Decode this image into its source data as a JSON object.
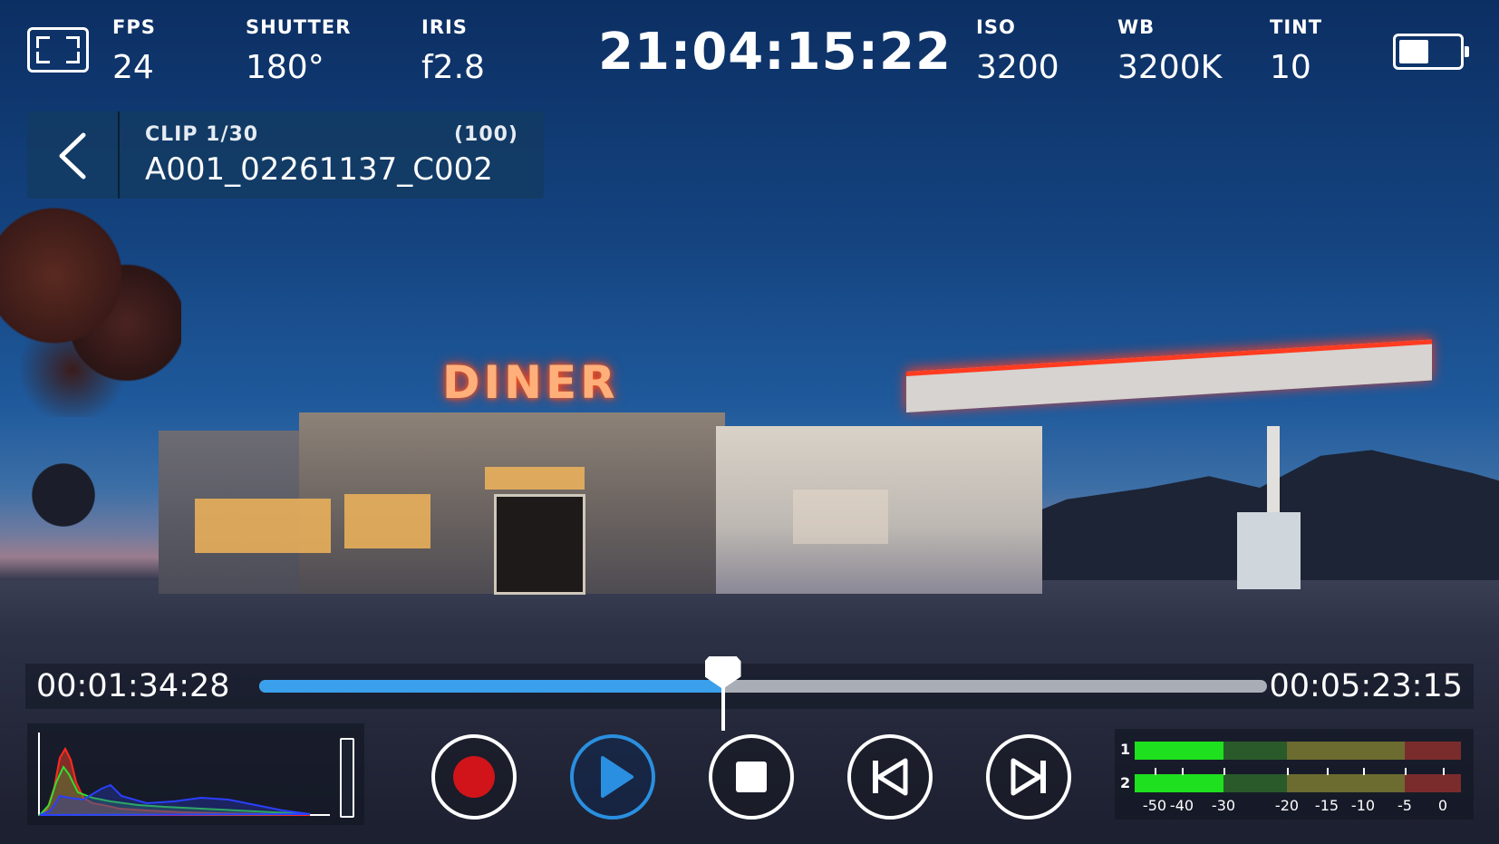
{
  "status": {
    "fps": {
      "label": "FPS",
      "value": "24"
    },
    "shutter": {
      "label": "SHUTTER",
      "value": "180°"
    },
    "iris": {
      "label": "IRIS",
      "value": "f2.8"
    },
    "timecode": "21:04:15:22",
    "iso": {
      "label": "ISO",
      "value": "3200"
    },
    "wb": {
      "label": "WB",
      "value": "3200K"
    },
    "tint": {
      "label": "TINT",
      "value": "10"
    },
    "battery_level": 0.5
  },
  "clip": {
    "index": "CLIP 1/30",
    "total": "(100)",
    "name": "A001_02261137_C002"
  },
  "scene": {
    "sign_text": "DINER"
  },
  "playback": {
    "current": "00:01:34:28",
    "duration": "00:05:23:15",
    "progress": 0.46
  },
  "controls": {
    "record": "record-icon",
    "play": "play-icon",
    "stop": "stop-icon",
    "prev": "skip-back-icon",
    "next": "skip-forward-icon",
    "accent_color": "#2a8fe0",
    "record_color": "#d0141a"
  },
  "audio": {
    "channels": [
      "1",
      "2"
    ],
    "scale": [
      "-50",
      "-40",
      "-30",
      "-20",
      "-15",
      "-10",
      "-5",
      "0"
    ],
    "levels": [
      -30,
      -30
    ],
    "colors": {
      "green": "#1ee01e",
      "olive": "#6c6c30",
      "red": "#7a2c2c",
      "dark_green": "#2a5a2a"
    }
  }
}
